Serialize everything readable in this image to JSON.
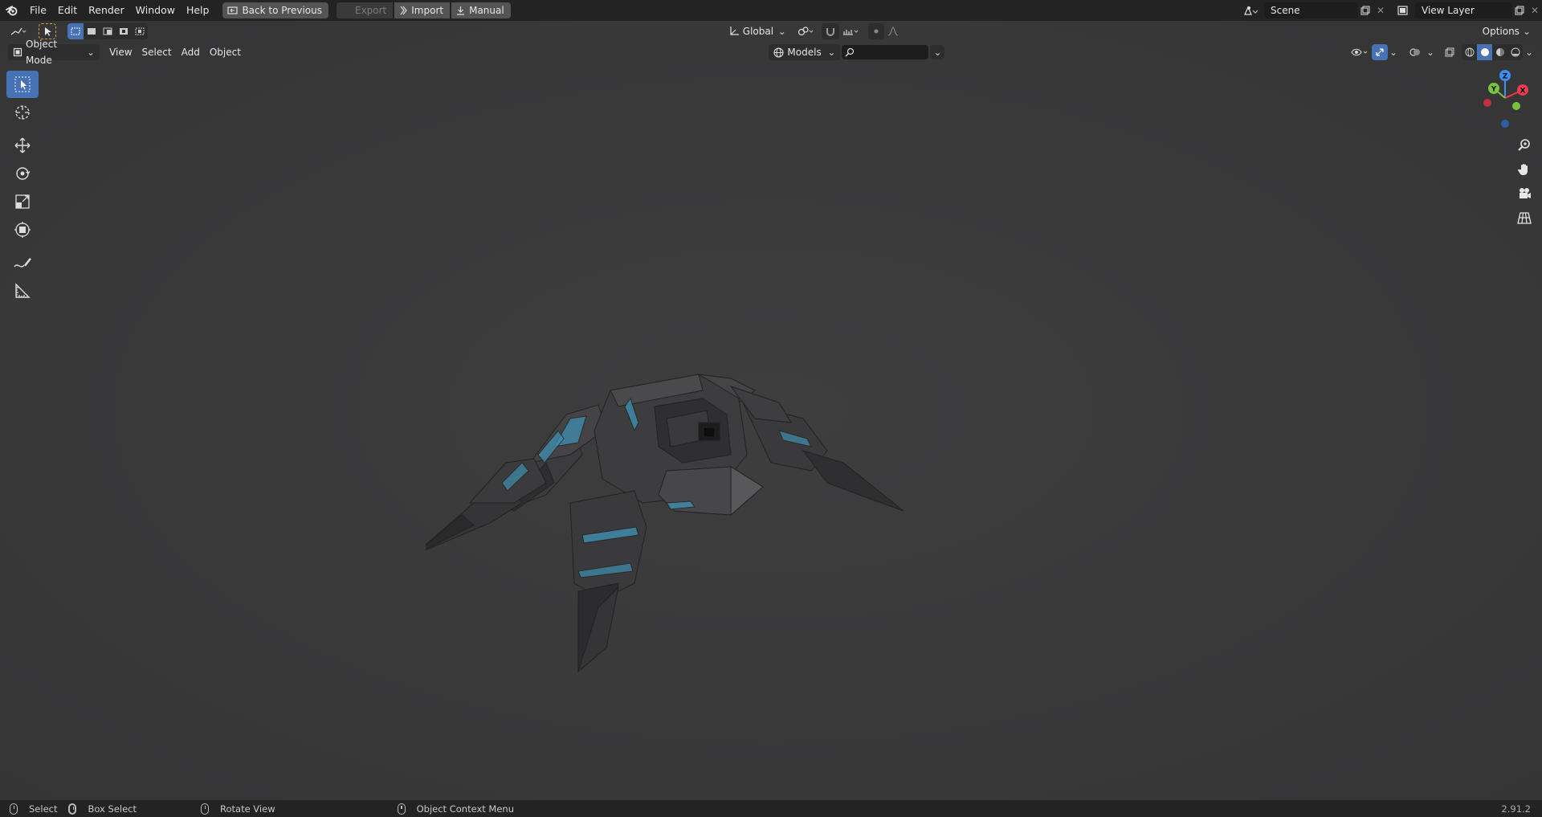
{
  "topbar": {
    "menus": [
      "File",
      "Edit",
      "Render",
      "Window",
      "Help"
    ],
    "back_to_previous": "Back to Previous",
    "export": "Export",
    "import": "Import",
    "manual": "Manual",
    "scene_value": "Scene",
    "view_layer_value": "View Layer"
  },
  "header1": {
    "transform_orientation": "Global",
    "options": "Options"
  },
  "header2": {
    "mode": "Object Mode",
    "menus": [
      "View",
      "Select",
      "Add",
      "Object"
    ],
    "collection": "Models",
    "search_value": ""
  },
  "statusbar": {
    "select": "Select",
    "box_select": "Box Select",
    "rotate_view": "Rotate View",
    "context_menu": "Object Context Menu",
    "version": "2.91.2"
  },
  "gizmo": {
    "x": "X",
    "y": "Y",
    "z": "Z",
    "colors": {
      "x": "#ee3b4d",
      "y": "#7ac23c",
      "z": "#3d8ef0"
    }
  },
  "colors": {
    "accent": "#4772b3",
    "background": "#3a3a3b",
    "model_trim": "#3f8fb0"
  }
}
